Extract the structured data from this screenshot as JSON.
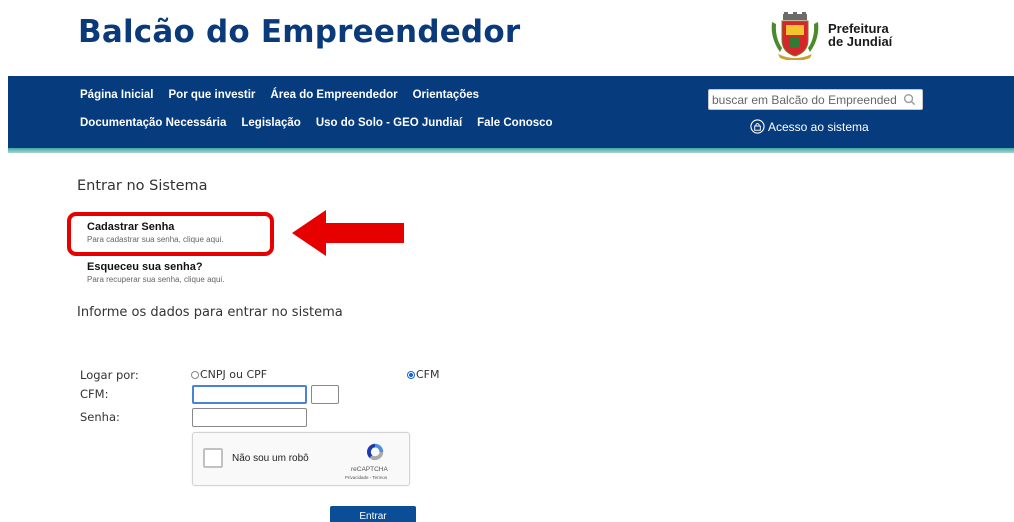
{
  "header": {
    "site_title": "Balcão do Empreendedor",
    "logo_line1": "Prefeitura",
    "logo_line2": "de Jundiaí"
  },
  "nav": {
    "row1": [
      "Página Inicial",
      "Por que investir",
      "Área do Empreendedor",
      "Orientações"
    ],
    "row2": [
      "Documentação Necessária",
      "Legislação",
      "Uso do Solo - GEO Jundiaí",
      "Fale Conosco"
    ],
    "search_placeholder": "buscar em Balcão do Empreendedor",
    "access_label": "Acesso ao sistema"
  },
  "login": {
    "title": "Entrar no Sistema",
    "register": {
      "title": "Cadastrar Senha",
      "desc": "Para cadastrar sua senha, clique aqui."
    },
    "forgot": {
      "title": "Esqueceu sua senha?",
      "desc": "Para recuperar sua senha, clique aqui."
    },
    "info_title": "Informe os dados para entrar no sistema"
  },
  "form": {
    "logar_por_label": "Logar por:",
    "option_cnpj": "CNPJ ou CPF",
    "option_cfm": "CFM",
    "selected_option": "CFM",
    "cfm_label": "CFM:",
    "senha_label": "Senha:",
    "cfm_value": "",
    "uf_value": "",
    "senha_value": ""
  },
  "captcha": {
    "label": "Não sou um robô",
    "brand": "reCAPTCHA",
    "terms": "Privacidade - Termos"
  },
  "submit_label": "Entrar",
  "colors": {
    "brand_blue": "#0b3a7a",
    "navbar": "#063b7d",
    "stripe": "#3fa7a0",
    "highlight": "#e60000",
    "button": "#0b4d96"
  }
}
